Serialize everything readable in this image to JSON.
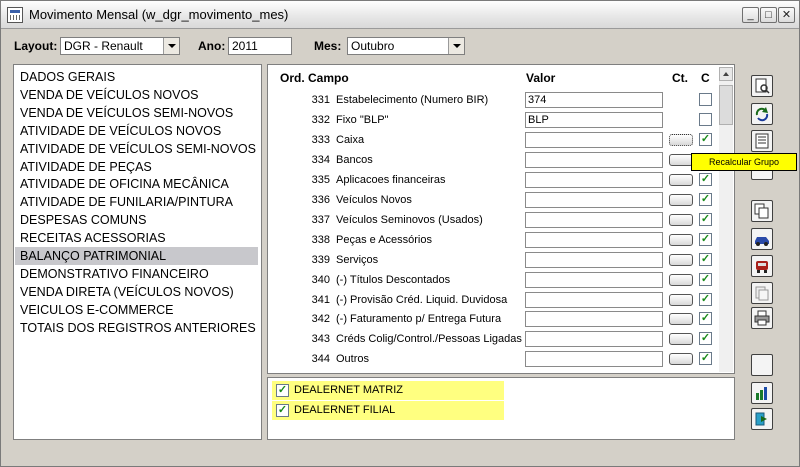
{
  "window": {
    "title": "Movimento Mensal (w_dgr_movimento_mes)"
  },
  "header": {
    "layout_label": "Layout:",
    "layout_value": "DGR - Renault",
    "ano_label": "Ano:",
    "ano_value": "2011",
    "mes_label": "Mes:",
    "mes_value": "Outubro"
  },
  "left_list": {
    "items": [
      "DADOS GERAIS",
      "VENDA DE VEÍCULOS NOVOS",
      "VENDA DE VEÍCULOS SEMI-NOVOS",
      "ATIVIDADE DE VEÍCULOS NOVOS",
      "ATIVIDADE DE VEÍCULOS SEMI-NOVOS",
      "ATIVIDADE DE PEÇAS",
      "ATIVIDADE DE OFICINA MECÂNICA",
      "ATIVIDADE DE FUNILARIA/PINTURA",
      "DESPESAS COMUNS",
      "RECEITAS ACESSORIAS",
      "BALANÇO PATRIMONIAL",
      "DEMONSTRATIVO FINANCEIRO",
      "VENDA DIRETA (VEÍCULOS NOVOS)",
      "VEICULOS E-COMMERCE",
      "TOTAIS DOS REGISTROS ANTERIORES"
    ],
    "selected": "BALANÇO PATRIMONIAL"
  },
  "grid": {
    "headers": {
      "ord": "Ord.",
      "campo": "Campo",
      "valor": "Valor",
      "ct": "Ct.",
      "c": "C"
    },
    "rows": [
      {
        "ord": "331",
        "campo": "Estabelecimento (Numero BIR)",
        "valor": "374",
        "ct": false,
        "c": false
      },
      {
        "ord": "332",
        "campo": "Fixo \"BLP\"",
        "valor": "BLP",
        "ct": false,
        "c": false
      },
      {
        "ord": "333",
        "campo": "Caixa",
        "valor": "",
        "ct": true,
        "c": true
      },
      {
        "ord": "334",
        "campo": "Bancos",
        "valor": "",
        "ct": true,
        "c": true
      },
      {
        "ord": "335",
        "campo": "Aplicacoes financeiras",
        "valor": "",
        "ct": true,
        "c": true
      },
      {
        "ord": "336",
        "campo": "Veículos Novos",
        "valor": "",
        "ct": true,
        "c": true
      },
      {
        "ord": "337",
        "campo": "Veículos Seminovos (Usados)",
        "valor": "",
        "ct": true,
        "c": true
      },
      {
        "ord": "338",
        "campo": "Peças e Acessórios",
        "valor": "",
        "ct": true,
        "c": true
      },
      {
        "ord": "339",
        "campo": "Serviços",
        "valor": "",
        "ct": true,
        "c": true
      },
      {
        "ord": "340",
        "campo": "(-) Títulos Descontados",
        "valor": "",
        "ct": true,
        "c": true
      },
      {
        "ord": "341",
        "campo": "(-) Provisão Créd. Liquid. Duvidosa",
        "valor": "",
        "ct": true,
        "c": true
      },
      {
        "ord": "342",
        "campo": "(-) Faturamento p/ Entrega Futura",
        "valor": "",
        "ct": true,
        "c": true
      },
      {
        "ord": "343",
        "campo": "Créds Colig/Control./Pessoas Ligadas",
        "valor": "",
        "ct": true,
        "c": true
      },
      {
        "ord": "344",
        "campo": "Outros",
        "valor": "",
        "ct": true,
        "c": true
      }
    ]
  },
  "bottom": {
    "items": [
      {
        "label": "DEALERNET MATRIZ",
        "checked": true
      },
      {
        "label": "DEALERNET FILIAL",
        "checked": true
      }
    ]
  },
  "tooltip": {
    "text": "Recalcular Grupo"
  },
  "toolbar": {
    "icons": [
      "print-preview-icon",
      "refresh-icon",
      "recalculate-group-icon",
      "blank-icon",
      "copy-icon",
      "car-icon",
      "vehicle-front-icon",
      "document-icon",
      "printer-icon",
      "blank-icon",
      "chart-icon",
      "exit-icon"
    ]
  },
  "colors": {
    "highlight_yellow": "#ffff80",
    "tooltip_yellow": "#ffff00",
    "selected_row": "#c8c8cc",
    "check_green": "#1a8a1a"
  }
}
